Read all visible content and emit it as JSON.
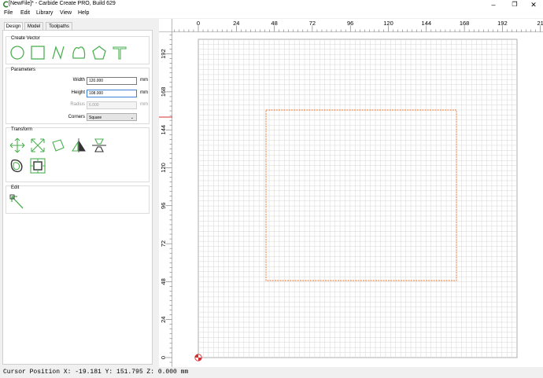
{
  "window": {
    "title": "[NewFile]* - Carbide Create PRO, Build 629",
    "minimize": "–",
    "restore": "❐",
    "close": "✕"
  },
  "menu": [
    "File",
    "Edit",
    "Library",
    "View",
    "Help"
  ],
  "tabs": [
    "Design",
    "Model",
    "Toolpaths"
  ],
  "create_vector": {
    "title": "Create Vector",
    "icons": [
      "circle-icon",
      "rectangle-icon",
      "polyline-icon",
      "curve-icon",
      "polygon-icon",
      "text-icon"
    ]
  },
  "parameters": {
    "title": "Parameters",
    "width_label": "Width",
    "width_value": "120.000",
    "width_unit": "mm",
    "height_label": "Height",
    "height_value": "108.000",
    "height_unit": "mm",
    "radius_label": "Radius",
    "radius_value": "6.000",
    "radius_unit": "mm",
    "corners_label": "Corners",
    "corners_value": "Square"
  },
  "transform": {
    "title": "Transform",
    "icons": [
      "move-icon",
      "scale-icon",
      "rotate-icon",
      "mirror-icon",
      "align-icon",
      "offset-icon",
      "center-icon"
    ]
  },
  "edit": {
    "title": "Edit",
    "icons": [
      "node-edit-icon"
    ]
  },
  "canvas": {
    "x_ticks": [
      "0",
      "24",
      "48",
      "72",
      "96",
      "120",
      "144",
      "168",
      "192",
      "21"
    ],
    "y_ticks": [
      "0",
      "24",
      "48",
      "72",
      "96",
      "120",
      "144",
      "168",
      "192"
    ],
    "accent": "#e8702a",
    "grid_color": "#d6d6d6"
  },
  "status": {
    "text": "Cursor Position X: -19.181 Y: 151.795 Z: 0.000 mm"
  }
}
